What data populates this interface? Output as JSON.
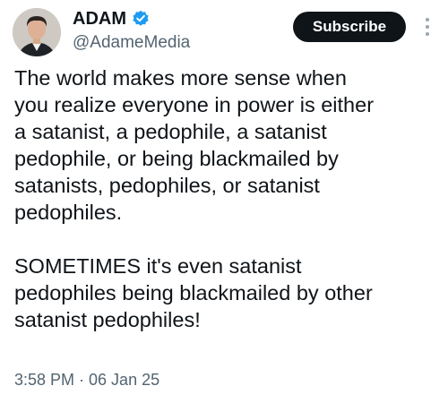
{
  "tweet": {
    "author": {
      "display_name": "ADAM",
      "handle": "@AdameMedia",
      "verified_icon": "verified-badge-icon",
      "avatar": "profile-photo"
    },
    "subscribe_label": "Subscribe",
    "more_icon": "more-vertical-icon",
    "body": {
      "paragraph_1_lines": [
        "The world makes more sense when",
        "you realize everyone in power is either",
        "a satanist, a pedophile, a satanist",
        "pedophile, or being blackmailed by",
        "satanists, pedophiles, or satanist",
        "pedophiles."
      ],
      "paragraph_2_lines": [
        "SOMETIMES it's even satanist",
        "pedophiles being blackmailed by other",
        "satanist pedophiles!"
      ]
    },
    "timestamp": "3:58 PM · 06 Jan 25"
  },
  "colors": {
    "text": "#0f1419",
    "secondary_text": "#536471",
    "verified_blue": "#1d9bf0",
    "button_bg": "#0f1419",
    "button_text": "#ffffff"
  }
}
